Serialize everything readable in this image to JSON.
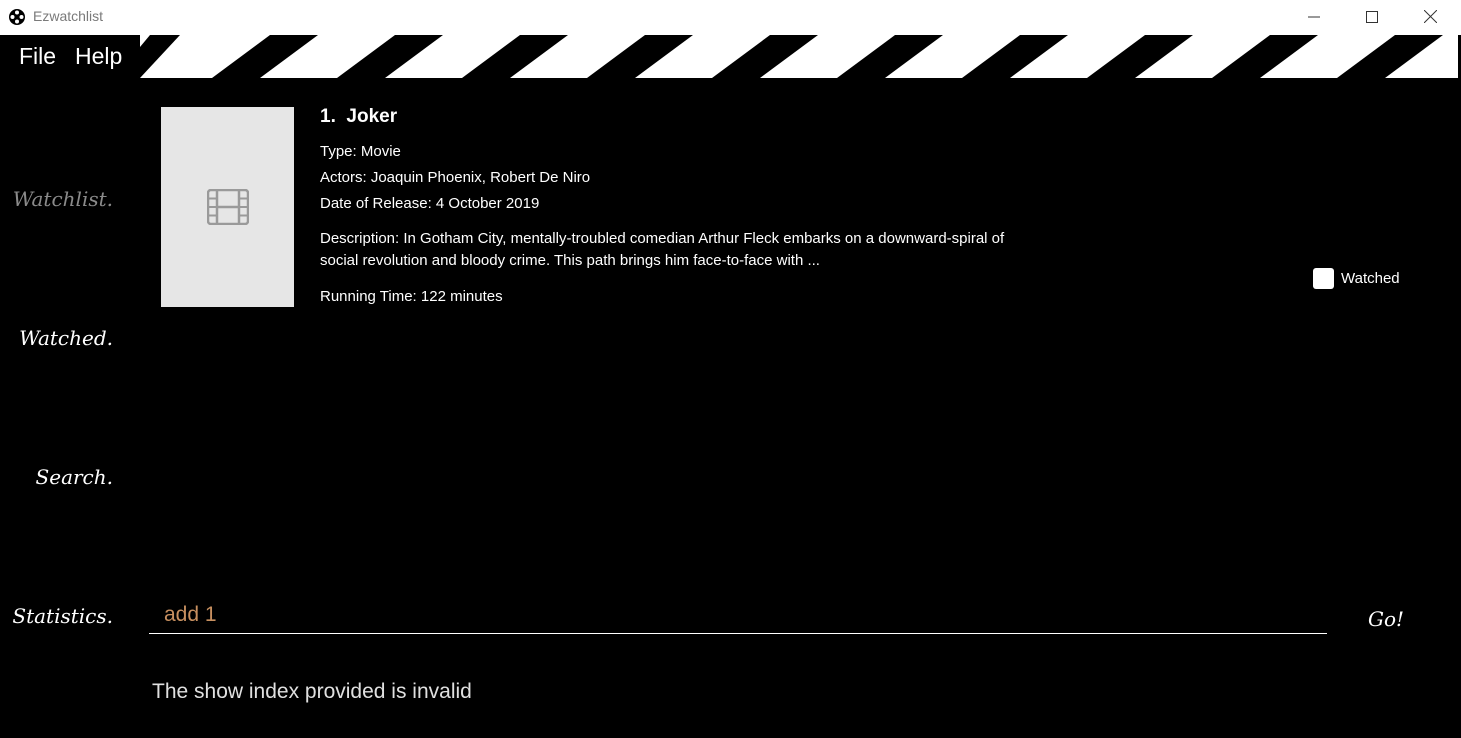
{
  "window": {
    "title": "Ezwatchlist",
    "controls": [
      "minimize-icon",
      "maximize-icon",
      "close-icon"
    ]
  },
  "menu": {
    "file": "File",
    "help": "Help"
  },
  "sidebar": {
    "items": [
      {
        "label": "Watchlist.",
        "active": true
      },
      {
        "label": "Watched.",
        "active": false
      },
      {
        "label": "Search.",
        "active": false
      },
      {
        "label": "Statistics.",
        "active": false
      }
    ]
  },
  "show": {
    "index": "1.",
    "title": "Joker",
    "type": "Type: Movie",
    "actors": "Actors:   Joaquin Phoenix, Robert De Niro",
    "release": "Date of Release: 4 October 2019",
    "description": "Description: In Gotham City, mentally-troubled comedian Arthur Fleck embarks on a downward-spiral of social revolution and bloody crime. This path brings him face-to-face with ...",
    "running_time": "Running Time: 122 minutes",
    "poster_icon": "film-icon",
    "watched_label": "Watched",
    "watched": false
  },
  "command": {
    "value": "add 1",
    "go_label": "Go!"
  },
  "result": {
    "message": "The show index provided is invalid"
  },
  "colors": {
    "background": "#000000",
    "command_text": "#c89060",
    "active_nav": "#8a8a8a",
    "poster_bg": "#e6e6e6"
  }
}
